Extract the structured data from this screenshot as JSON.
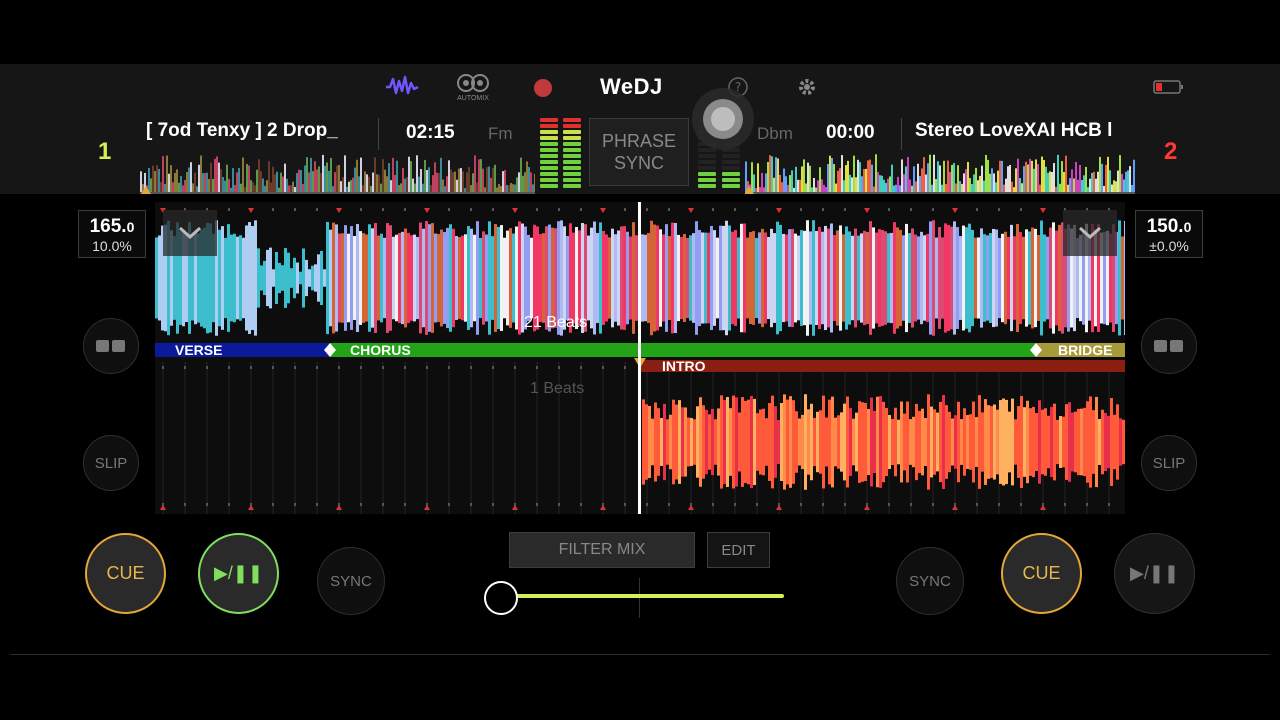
{
  "app": {
    "logo": "WeDJ",
    "automix_label": "AUTOMIX"
  },
  "deck1": {
    "number": "1",
    "track_title": "[ 7od Tenxy ] 2 Drop_",
    "time": "02:15",
    "key": "Fm",
    "bpm_int": "165.",
    "bpm_dec": "0",
    "pitch": "10.0%",
    "slip_label": "SLIP",
    "cue_label": "CUE",
    "sync_label": "SYNC",
    "play_label": "▶/❚❚"
  },
  "deck2": {
    "number": "2",
    "track_title": "Stereo LoveXAI HCB l",
    "time": "00:00",
    "key": "Dbm",
    "bpm_int": "150.",
    "bpm_dec": "0",
    "pitch": "±0.0%",
    "slip_label": "SLIP",
    "cue_label": "CUE",
    "sync_label": "SYNC",
    "play_label": "▶/❚❚"
  },
  "center": {
    "phrase_sync_line1": "PHRASE",
    "phrase_sync_line2": "SYNC",
    "filter_mix_label": "FILTER MIX",
    "edit_label": "EDIT",
    "crossfader_value": 0.0
  },
  "waveform": {
    "top_beats_label": "21 Beats",
    "bottom_beats_label": "1 Beats",
    "top_phrases": [
      "VERSE",
      "CHORUS",
      "BRIDGE"
    ],
    "bottom_phrases": [
      "INTRO"
    ]
  },
  "icons": {
    "waveform_view": "waveform-icon",
    "automix": "automix-icon",
    "record": "record-icon",
    "help": "help-icon",
    "settings": "gear-icon",
    "battery": "battery-icon",
    "collapse": "chevron-down-icon",
    "loop": "loop-icon"
  },
  "colors": {
    "accent_green": "#7fe05e",
    "cue_orange": "#e5a63a",
    "deck1_color": "#d6ef52",
    "deck2_color": "#ff3b30",
    "verse": "#0a1a9a",
    "chorus": "#22a318",
    "bridge": "#a89a3a",
    "intro": "#8a1e10"
  }
}
